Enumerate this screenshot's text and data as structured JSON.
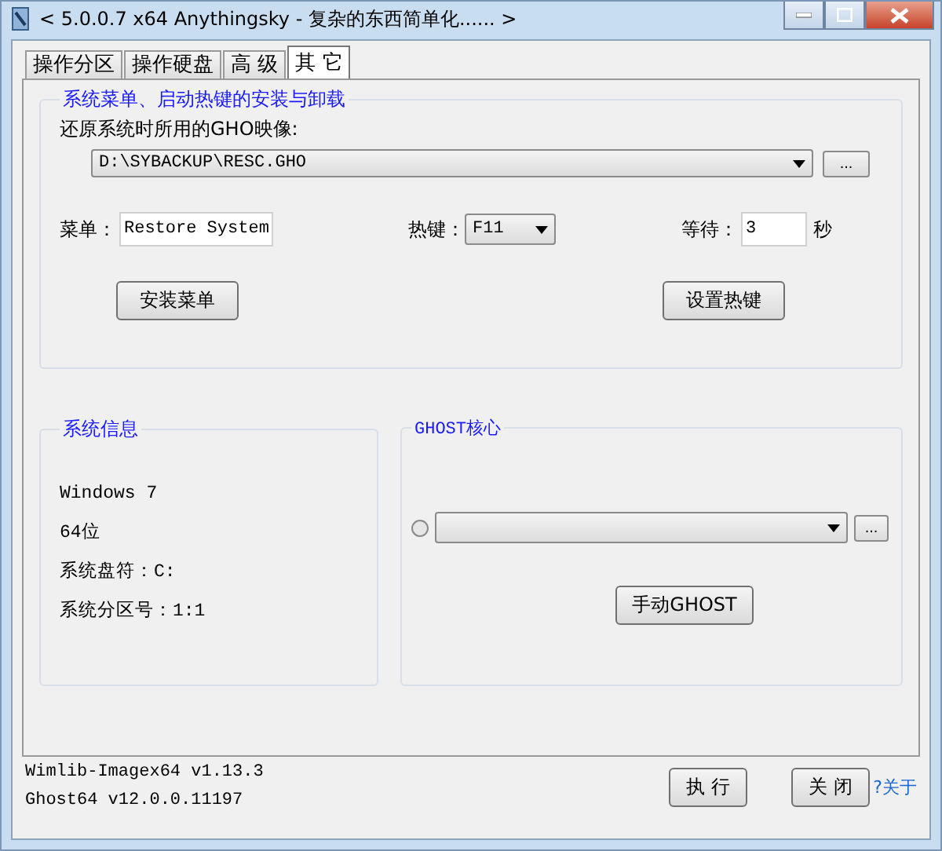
{
  "window": {
    "title": "< 5.0.0.7 x64 Anythingsky - 复杂的东西简单化...... >"
  },
  "tabs": [
    {
      "label": "操作分区",
      "selected": false
    },
    {
      "label": "操作硬盘",
      "selected": false
    },
    {
      "label": "高 级",
      "selected": false
    },
    {
      "label": "其 它",
      "selected": true
    }
  ],
  "menu_group": {
    "title": "系统菜单、启动热键的安装与卸载",
    "image_label": "还原系统时所用的GHO映像:",
    "image_path": "D:\\SYBACKUP\\RESC.GHO",
    "browse_button": "...",
    "menu_label": "菜单：",
    "menu_value": "Restore System",
    "hotkey_label": "热键：",
    "hotkey_value": "F11",
    "wait_label": "等待：",
    "wait_value": "3",
    "wait_unit": "秒",
    "install_button": "安装菜单",
    "set_hotkey_button": "设置热键"
  },
  "system_info": {
    "title": "系统信息",
    "lines": [
      "Windows 7",
      "64位",
      "系统盘符：C:",
      "系统分区号：1:1"
    ]
  },
  "ghost_core": {
    "title": "GHOST核心",
    "radio_checked": false,
    "browse_button": "...",
    "manual_button": "手动GHOST"
  },
  "footer": {
    "versions": [
      "Wimlib-Imagex64 v1.13.3",
      "Ghost64 v12.0.0.11197"
    ],
    "buttons": [
      "执 行",
      "关 闭"
    ],
    "about_link": "?关于"
  }
}
